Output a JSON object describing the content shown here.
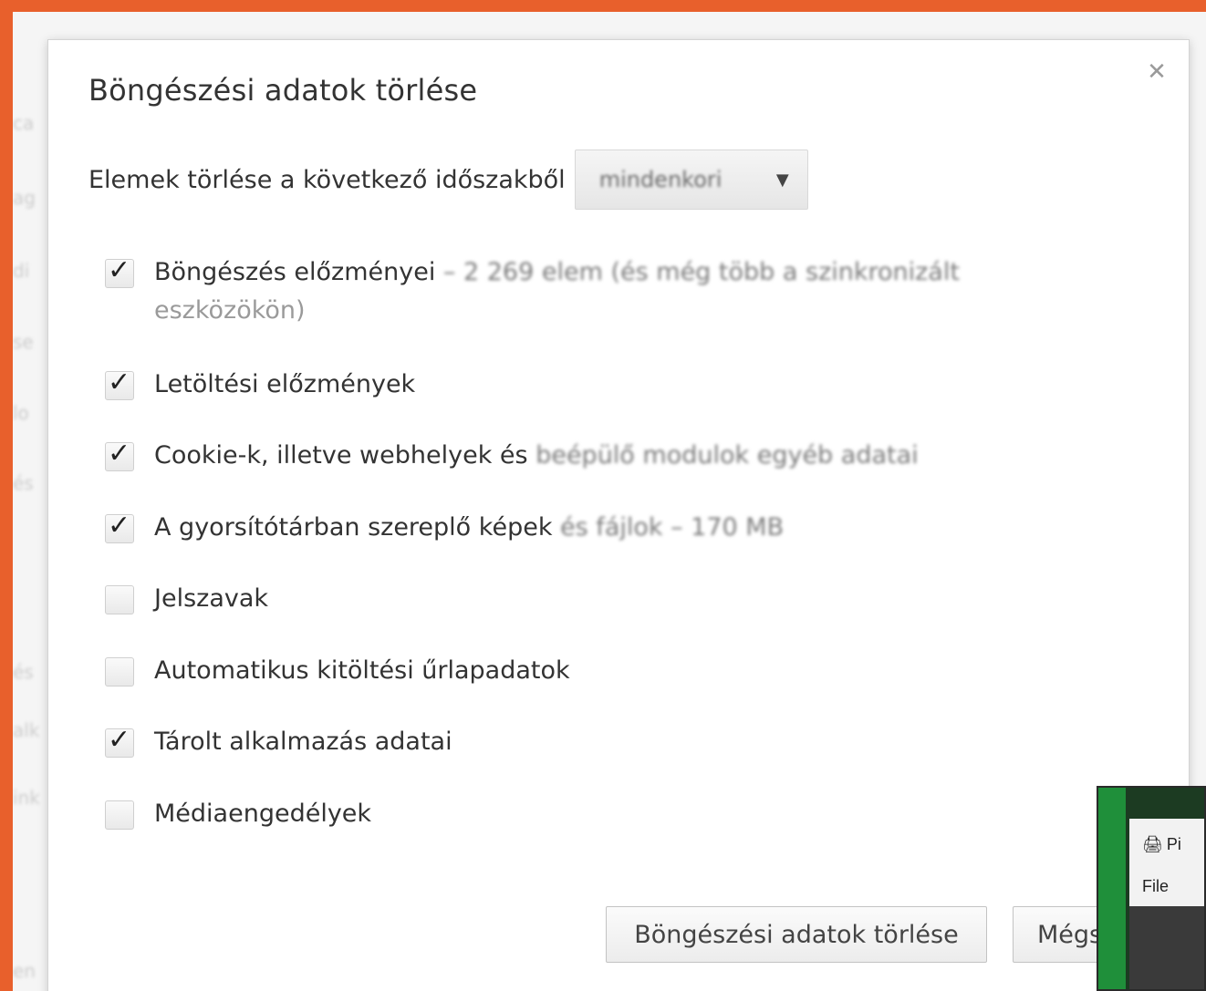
{
  "background": {
    "items": [
      "ca",
      "ag",
      "di",
      "se",
      "lo",
      "és",
      "és",
      "alk",
      "ink",
      "en"
    ]
  },
  "dialog": {
    "title": "Böngészési adatok törlése",
    "close_icon": "close-icon",
    "period_label": "Elemek törlése a következő időszakből",
    "period_value": "mindenkori",
    "options": [
      {
        "label": "Böngészés előzményei",
        "detail": " – 2 269 elem (és még több a szinkronizált",
        "detail2": "eszközökön)",
        "checked": true
      },
      {
        "label": "Letöltési előzmények",
        "detail": "",
        "checked": true
      },
      {
        "label": "Cookie-k, illetve webhelyek és ",
        "detail": "beépülő modulok egyéb adatai",
        "checked": true
      },
      {
        "label": "A gyorsítótárban szereplő képek",
        "detail": " és fájlok – 170 MB",
        "checked": true
      },
      {
        "label": "Jelszavak",
        "detail": "",
        "checked": false
      },
      {
        "label": "Automatikus kitöltési űrlapadatok",
        "detail": "",
        "checked": false
      },
      {
        "label": "Tárolt alkalmazás adatai",
        "detail": "",
        "checked": true
      },
      {
        "label": "Médiaengedélyek",
        "detail": "",
        "checked": false
      }
    ],
    "clear_button": "Böngészési adatok törlése",
    "cancel_button": "Mégse"
  },
  "thumbnail": {
    "title": "Pi",
    "menu": "File"
  }
}
